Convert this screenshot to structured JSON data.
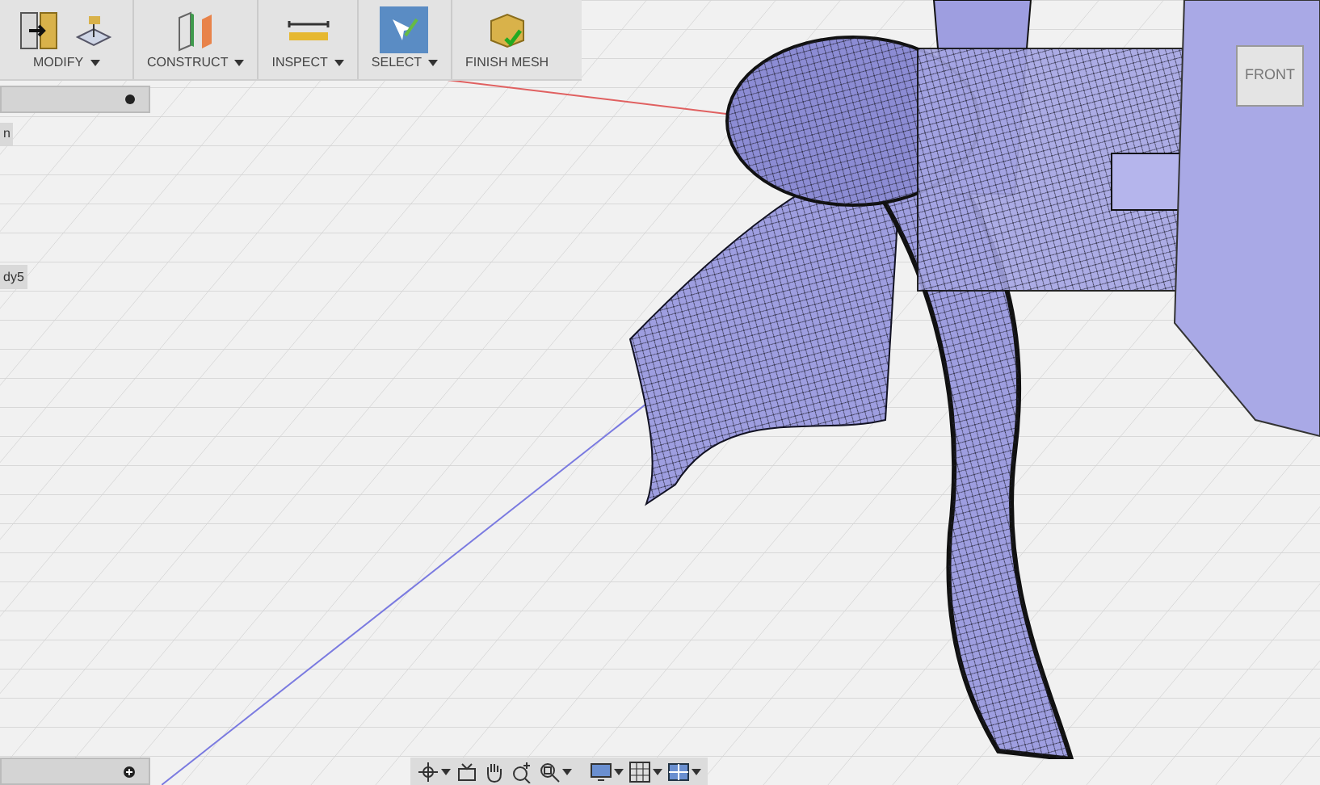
{
  "toolbar": {
    "groups": [
      {
        "label": "MODIFY",
        "dropdown": true,
        "selected": false,
        "kind": "modify"
      },
      {
        "label": "CONSTRUCT",
        "dropdown": true,
        "selected": false,
        "kind": "construct"
      },
      {
        "label": "INSPECT",
        "dropdown": true,
        "selected": false,
        "kind": "inspect"
      },
      {
        "label": "SELECT",
        "dropdown": true,
        "selected": true,
        "kind": "select"
      },
      {
        "label": "FINISH MESH",
        "dropdown": false,
        "selected": false,
        "kind": "finish"
      }
    ]
  },
  "side_tabs": [
    "n",
    "dy5"
  ],
  "view_cube": {
    "face": "FRONT"
  },
  "nav_bar": {
    "tools": [
      {
        "kind": "orbit",
        "dropdown": true
      },
      {
        "kind": "look",
        "dropdown": false
      },
      {
        "kind": "pan",
        "dropdown": false
      },
      {
        "kind": "zoom",
        "dropdown": false
      },
      {
        "kind": "fit",
        "dropdown": true
      },
      {
        "kind": "display",
        "dropdown": true
      },
      {
        "kind": "grid",
        "dropdown": true
      },
      {
        "kind": "viewports",
        "dropdown": true
      }
    ]
  }
}
